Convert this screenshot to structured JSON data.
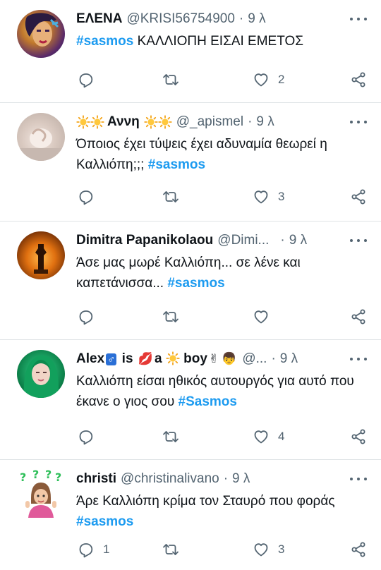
{
  "tweets": [
    {
      "name": "ΕΛΕΝΑ",
      "handle": "@KRISI56754900",
      "time": "9 λ",
      "text_before": "",
      "hashtag": "#sasmos",
      "text_after": " ΚΑΛΛΙΟΠΗ ΕΙΣΑΙ ΕΜΕΤΟΣ",
      "replies": "",
      "likes": "2"
    },
    {
      "name": "Αννη",
      "handle": "@_apismel",
      "time": "9 λ",
      "text_before": "Όποιος έχει τύψεις έχει αδυναμία θεωρεί η Καλλιόπη;;; ",
      "hashtag": "#sasmos",
      "text_after": "",
      "replies": "",
      "likes": "3"
    },
    {
      "name": "Dimitra Papanikolaou",
      "handle": "@Dimi...",
      "time": "9 λ",
      "text_before": "Άσε μας μωρέ Καλλιόπη... σε λένε και καπετάνισσα... ",
      "hashtag": "#sasmos",
      "text_after": "",
      "replies": "",
      "likes": ""
    },
    {
      "name_parts": [
        "Alex",
        "♂",
        " is ",
        "💋",
        "a ",
        "☀",
        " boy",
        "✌",
        "👦"
      ],
      "handle": "@...",
      "time": "9 λ",
      "text_before": "Καλλιόπη είσαι ηθικός αυτουργός για αυτό που έκανε ο γιος σου ",
      "hashtag": "#Sasmos",
      "text_after": "",
      "replies": "",
      "likes": "4"
    },
    {
      "name": "christi",
      "handle": "@christinalivano",
      "time": "9 λ",
      "text_before": "Άρε Καλλιόπη κρίμα τον Σταυρό που φοράς  ",
      "hashtag": "#sasmos",
      "text_after": "",
      "replies": "1",
      "likes": "3"
    }
  ],
  "separator": "·",
  "icons": [
    "reply-icon",
    "retweet-icon",
    "like-icon",
    "share-icon",
    "more-icon",
    "sun-emoji-icon"
  ],
  "colors": {
    "hashtag": "#1d9bf0",
    "secondary_text": "#536471",
    "divider": "#dfe3e6"
  }
}
